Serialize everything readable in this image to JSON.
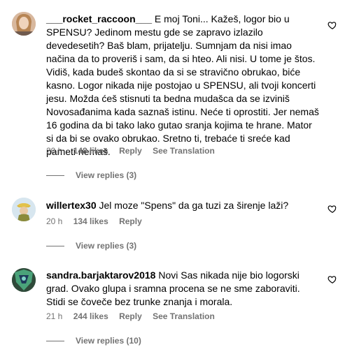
{
  "comments": [
    {
      "username": "___rocket_raccoon___",
      "text": "E moj Toni... Kažeš, logor bio u SPENSU? Jedinom mestu gde se zapravo izlazilo devedesetih? Baš blam, prijatelju. Sumnjam da nisi imao načina da to proveriš i sam, da si hteo. Ali nisi. U tome je štos. Vidiš, kada budeš skontao da si se stravično obrukao, biće kasno. Logor nikada nije postojao u SPENSU, ali tvoji koncerti jesu. Možda ćeš stisnuti ta bedna mudašca da se izviniš Novosađanima kada saznaš istinu. Neće ti oprostiti. Jer nemaš 16 godina da bi tako lako gutao sranja kojima te hrane. Mator si da bi se ovako obrukao. Sretno ti, trebaće ti sreće kad pameti nemaš.",
      "time": "20 h",
      "likes": "148 likes",
      "reply": "Reply",
      "translation": "See Translation",
      "view_replies": "View replies (3)"
    },
    {
      "username": "willertex30",
      "text": "Jel moze \"Spens\" da ga tuzi za širenje laži?",
      "time": "20 h",
      "likes": "134 likes",
      "reply": "Reply",
      "translation": "",
      "view_replies": "View replies (3)"
    },
    {
      "username": "sandra.barjaktarov2018",
      "text": "Novi Sas nikada nije bio logorski grad. Ovako glupa i sramna procena se ne sme zaboraviti. Stidi se čoveče bez trunke znanja i morala.",
      "time": "21 h",
      "likes": "244 likes",
      "reply": "Reply",
      "translation": "See Translation",
      "view_replies": "View replies (10)"
    }
  ],
  "icons": {
    "like": "heart-outline-icon",
    "avatar": "user-avatar"
  }
}
